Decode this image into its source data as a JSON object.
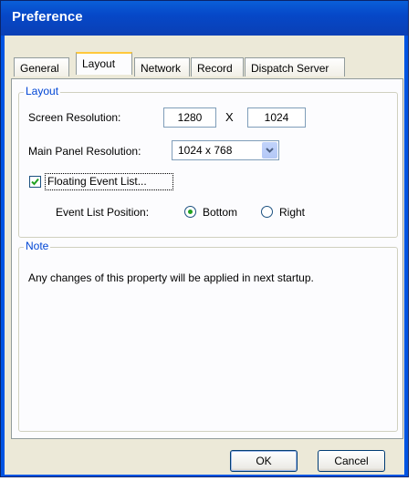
{
  "window": {
    "title": "Preference"
  },
  "tabs": [
    {
      "label": "General",
      "active": false
    },
    {
      "label": "Layout",
      "active": true
    },
    {
      "label": "Network",
      "active": false
    },
    {
      "label": "Record",
      "active": false
    },
    {
      "label": "Dispatch Server",
      "active": false
    }
  ],
  "layout_group": {
    "legend": "Layout",
    "screen_resolution_label": "Screen Resolution:",
    "screen_width": "1280",
    "separator": "X",
    "screen_height": "1024",
    "main_panel_label": "Main Panel Resolution:",
    "main_panel_value": "1024 x 768",
    "floating_label": "Floating Event List...",
    "floating_checked": true,
    "position_label": "Event List Position:",
    "position_bottom": "Bottom",
    "position_right": "Right",
    "position_selected": "Bottom"
  },
  "note_group": {
    "legend": "Note",
    "text": "Any changes of this property will be applied in next startup."
  },
  "buttons": {
    "ok": "OK",
    "cancel": "Cancel"
  },
  "icons": {
    "dropdown": "chevron-down-icon",
    "check": "checkmark-icon"
  },
  "colors": {
    "titlebar": "#0054e3",
    "legend": "#0046d5",
    "radio_dot": "#21a121",
    "tab_highlight": "#ffc83c"
  }
}
